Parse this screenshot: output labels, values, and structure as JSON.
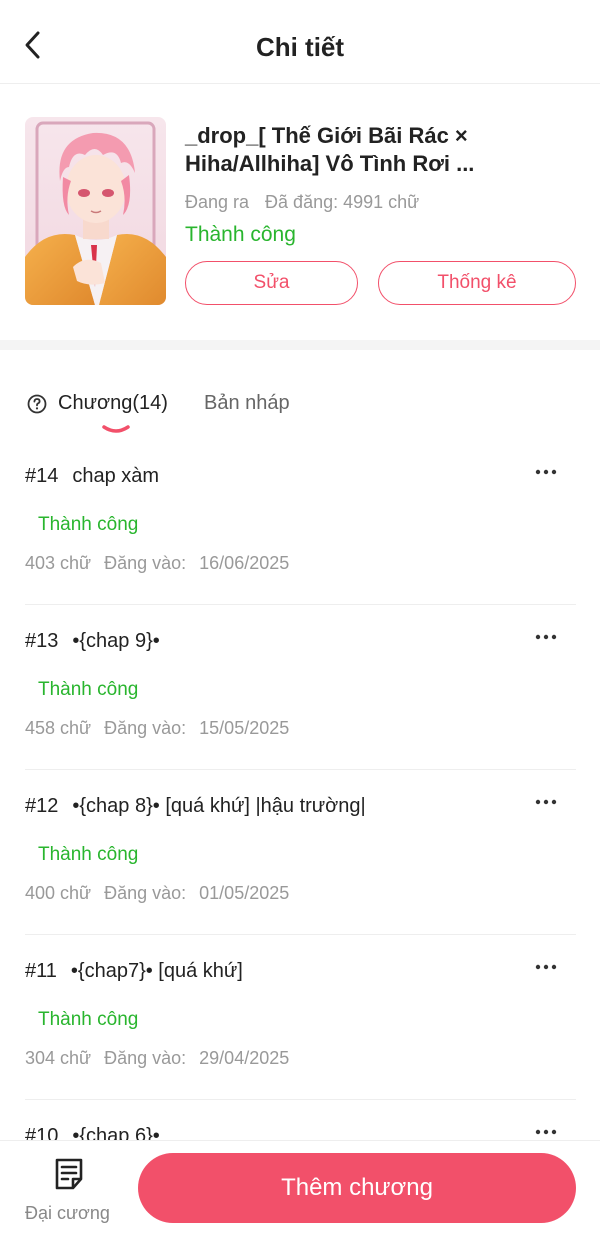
{
  "header": {
    "title": "Chi tiết"
  },
  "book": {
    "title_line1": "_drop_[ Thế Giới Bãi Rác ×",
    "title_line2": "Hiha/Allhiha] Vô Tình Rơi ...",
    "state": "Đang ra",
    "word_count": "Đã đăng: 4991 chữ",
    "status": "Thành công",
    "edit_label": "Sửa",
    "stats_label": "Thống kê"
  },
  "tabs": {
    "chapters_label": "Chương(14)",
    "drafts_label": "Bản nháp"
  },
  "chapters": [
    {
      "num": "#14",
      "title": "chap xàm",
      "status": "Thành công",
      "words": "403 chữ",
      "posted_label": "Đăng vào:",
      "date": "16/06/2025"
    },
    {
      "num": "#13",
      "title": "•{chap 9}•",
      "status": "Thành công",
      "words": "458 chữ",
      "posted_label": "Đăng vào:",
      "date": "15/05/2025"
    },
    {
      "num": "#12",
      "title": "•{chap 8}• [quá khứ] |hậu trường|",
      "status": "Thành công",
      "words": "400 chữ",
      "posted_label": "Đăng vào:",
      "date": "01/05/2025"
    },
    {
      "num": "#11",
      "title": "•{chap7}• [quá khứ]",
      "status": "Thành công",
      "words": "304 chữ",
      "posted_label": "Đăng vào:",
      "date": "29/04/2025"
    },
    {
      "num": "#10",
      "title": "•{chap 6}•",
      "status": "",
      "words": "",
      "posted_label": "",
      "date": ""
    }
  ],
  "bottom": {
    "outline_label": "Đại cương",
    "add_chapter_label": "Thêm chương"
  },
  "colors": {
    "accent": "#f2506a",
    "success": "#29b52e",
    "muted": "#999999"
  },
  "icons": {
    "back": "chevron-left-icon",
    "help": "question-circle-icon",
    "more": "more-horizontal-icon",
    "outline": "document-lines-icon"
  }
}
